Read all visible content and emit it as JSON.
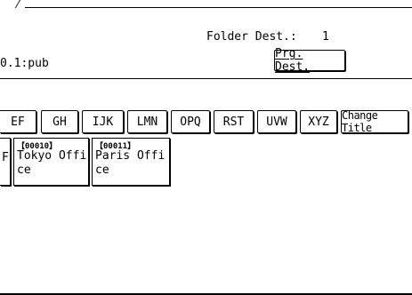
{
  "header": {
    "folder_dest_label": "Folder Dest.:",
    "folder_dest_count": "1",
    "path": "0.1:pub",
    "prg_dest_label": "Prg. Dest."
  },
  "tabs": [
    {
      "label": "EF"
    },
    {
      "label": "GH"
    },
    {
      "label": "IJK"
    },
    {
      "label": "LMN"
    },
    {
      "label": "OPQ"
    },
    {
      "label": "RST"
    },
    {
      "label": "UVW"
    },
    {
      "label": "XYZ"
    },
    {
      "label": "Change Title"
    }
  ],
  "destinations": [
    {
      "number": "",
      "name": "F"
    },
    {
      "number": "【00010】",
      "name": "Tokyo Offi\nce"
    },
    {
      "number": "【00011】",
      "name": "Paris Offi\nce"
    }
  ]
}
